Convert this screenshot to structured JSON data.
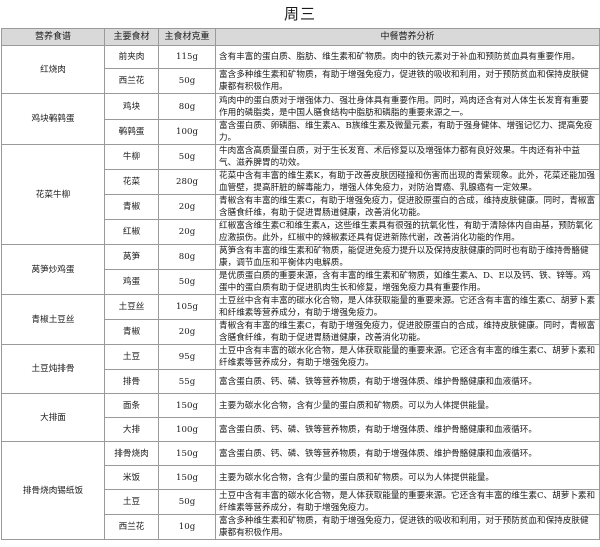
{
  "title": "周三",
  "headers": [
    "营养食谱",
    "主要食材",
    "主食材克重",
    "中餐营养分析"
  ],
  "dishes": [
    {
      "name": "红烧肉",
      "items": [
        {
          "ingredient": "前夹肉",
          "weight": "115g",
          "note": "含有丰富的蛋白质、脂肪、维生素和矿物质。肉中的铁元素对于补血和预防贫血具有重要作用。"
        },
        {
          "ingredient": "西兰花",
          "weight": "50g",
          "note": "富含多种维生素和矿物质，有助于增强免疫力，促进铁的吸收和利用，对于预防贫血和保持皮肤健康都有积极作用。"
        }
      ]
    },
    {
      "name": "鸡块鹌鹑蛋",
      "items": [
        {
          "ingredient": "鸡块",
          "weight": "80g",
          "note": "鸡肉中的蛋白质对于增强体力、强壮身体具有重要作用。同时，鸡肉还含有对人体生长发育有重要作用的磷脂类，是中国人膳食结构中脂肪和磷脂的重要来源之一。"
        },
        {
          "ingredient": "鹌鹑蛋",
          "weight": "100g",
          "note": "富含蛋白质、卵磷脂、维生素A、B族维生素及微量元素，有助于强身健体、增强记忆力、提高免疫力。"
        }
      ]
    },
    {
      "name": "花菜牛柳",
      "items": [
        {
          "ingredient": "牛柳",
          "weight": "50g",
          "note": "牛肉富含高质量蛋白质，对于生长发育、术后修复以及增强体力都有良好效果。牛肉还有补中益气、滋养脾胃的功效。"
        },
        {
          "ingredient": "花菜",
          "weight": "280g",
          "note": "花菜中含有丰富的维生素K，有助于改善皮肤因碰撞和伤害而出现的青紫现象。此外，花菜还能加强血管壁，提高肝脏的解毒能力，增强人体免疫力，对防治胃癌、乳腺癌有一定效果。"
        },
        {
          "ingredient": "青椒",
          "weight": "20g",
          "note": "青椒含有丰富的维生素C，有助于增强免疫力，促进胶原蛋白的合成，维持皮肤健康。同时，青椒富含膳食纤维，有助于促进胃肠道健康，改善消化功能。"
        },
        {
          "ingredient": "红椒",
          "weight": "20g",
          "note": "红椒富含维生素C和维生素A，这些维生素具有很强的抗氧化性，有助于清除体内自由基，预防氧化应激损伤。此外，红椒中的辣椒素还具有促进新陈代谢，改善消化功能的作用。"
        }
      ]
    },
    {
      "name": "莴笋炒鸡蛋",
      "items": [
        {
          "ingredient": "莴笋",
          "weight": "80g",
          "note": "莴笋含有丰富的维生素和矿物质，能促进免疫力提升以及保持皮肤健康的同时也有助于维持骨骼健康，调节血压和平衡体内电解质。"
        },
        {
          "ingredient": "鸡蛋",
          "weight": "50g",
          "note": "是优质蛋白质的重要来源，含有丰富的维生素和矿物质，如维生素A、D、E以及钙、铁、锌等。鸡蛋中的蛋白质有助于促进肌肉生长和修复，增强免疫力具有重要作用。"
        }
      ]
    },
    {
      "name": "青椒土豆丝",
      "items": [
        {
          "ingredient": "土豆丝",
          "weight": "105g",
          "note": "土豆丝中含有丰富的碳水化合物，是人体获取能量的重要来源。它还含有丰富的维生素C、胡萝卜素和纤维素等营养成分，有助于增强免疫力。"
        },
        {
          "ingredient": "青椒",
          "weight": "20g",
          "note": "青椒含有丰富的维生素C，有助于增强免疫力，促进胶原蛋白的合成，维持皮肤健康。同时，青椒富含膳食纤维，有助于促进胃肠道健康，改善消化功能。"
        }
      ]
    },
    {
      "name": "土豆炖排骨",
      "items": [
        {
          "ingredient": "土豆",
          "weight": "95g",
          "note": "土豆中含有丰富的碳水化合物，是人体获取能量的重要来源。它还含有丰富的维生素C、胡萝卜素和纤维素等营养成分，有助于增强免疫力。"
        },
        {
          "ingredient": "排骨",
          "weight": "55g",
          "note": "富含蛋白质、钙、磷、铁等营养物质，有助于增强体质、维护骨骼健康和血液循环。"
        }
      ]
    },
    {
      "name": "大排面",
      "items": [
        {
          "ingredient": "面条",
          "weight": "150g",
          "note": "主要为碳水化合物，含有少量的蛋白质和矿物质。可以为人体提供能量。"
        },
        {
          "ingredient": "大排",
          "weight": "100g",
          "note": "富含蛋白质、钙、磷、铁等营养物质，有助于增强体质、维护骨骼健康和血液循环。"
        }
      ]
    },
    {
      "name": "排骨烧肉锡纸饭",
      "items": [
        {
          "ingredient": "排骨烧肉",
          "weight": "150g",
          "note": "富含蛋白质、钙、磷、铁等营养物质，有助于增强体质、维护骨骼健康和血液循环。"
        },
        {
          "ingredient": "米饭",
          "weight": "150g",
          "note": "主要为碳水化合物，含有少量的蛋白质和矿物质。可以为人体提供能量。"
        },
        {
          "ingredient": "土豆",
          "weight": "50g",
          "note": "土豆中含有丰富的碳水化合物，是人体获取能量的重要来源。它还含有丰富的维生素C、胡萝卜素和纤维素等营养成分，有助于增强免疫力。"
        },
        {
          "ingredient": "西兰花",
          "weight": "10g",
          "note": "富含多种维生素和矿物质，有助于增强免疫力，促进铁的吸收和利用，对于预防贫血和保持皮肤健康都有积极作用。"
        }
      ]
    }
  ]
}
